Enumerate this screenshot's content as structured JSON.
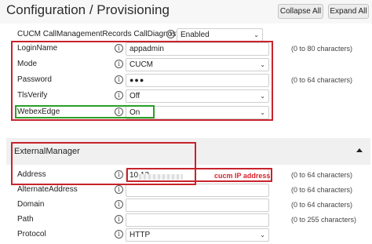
{
  "header": {
    "title": "Configuration / Provisioning",
    "collapse_all": "Collapse All",
    "expand_all": "Expand All"
  },
  "section1": {
    "rows": [
      {
        "label": "CUCM CallManagementRecords CallDiagnostics",
        "value": "Enabled",
        "type": "select",
        "hint": ""
      },
      {
        "label": "LoginName",
        "value": "appadmin",
        "type": "text",
        "hint": "(0 to 80 characters)"
      },
      {
        "label": "Mode",
        "value": "CUCM",
        "type": "select",
        "hint": ""
      },
      {
        "label": "Password",
        "value": "●●●",
        "type": "password",
        "hint": "(0 to 64 characters)"
      },
      {
        "label": "TlsVerify",
        "value": "Off",
        "type": "select",
        "hint": ""
      },
      {
        "label": "WebexEdge",
        "value": "On",
        "type": "select",
        "hint": ""
      }
    ]
  },
  "section2": {
    "title": "ExternalManager",
    "annotation": "cucm IP address",
    "rows": [
      {
        "label": "Address",
        "value": "10.12",
        "type": "text",
        "hint": "(0 to 64 characters)"
      },
      {
        "label": "AlternateAddress",
        "value": "",
        "type": "text",
        "hint": "(0 to 64 characters)"
      },
      {
        "label": "Domain",
        "value": "",
        "type": "text",
        "hint": "(0 to 64 characters)"
      },
      {
        "label": "Path",
        "value": "",
        "type": "text",
        "hint": "(0 to 255 characters)"
      },
      {
        "label": "Protocol",
        "value": "HTTP",
        "type": "select",
        "hint": ""
      }
    ]
  },
  "icons": {
    "info": "info-icon",
    "dropdown": "chevron-down-icon",
    "collapse": "caret-up-icon"
  },
  "colors": {
    "highlight_red": "#c8232c",
    "highlight_green": "#2aa02a"
  }
}
